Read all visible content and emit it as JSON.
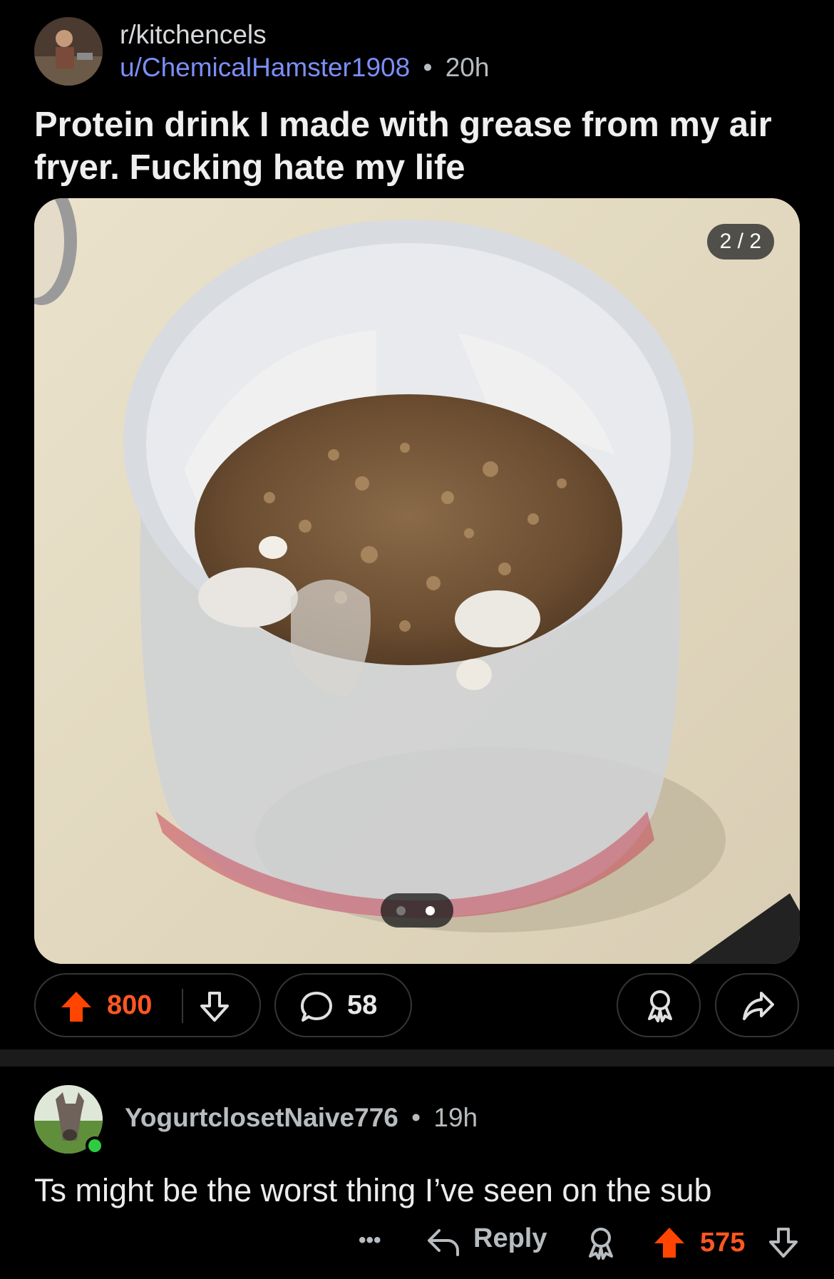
{
  "post": {
    "subreddit": "r/kitchencels",
    "author": "u/ChemicalHamster1908",
    "separator": "•",
    "age": "20h",
    "title": "Protein drink I made with grease from my air fryer. Fucking hate my life",
    "media_counter": "2 / 2",
    "gallery": {
      "current_index": 2,
      "total": 2
    },
    "upvotes": "800",
    "comments": "58"
  },
  "comment": {
    "author": "YogurtclosetNaive776",
    "separator": "•",
    "age": "19h",
    "body": "Ts might be the worst thing I’ve seen on the sub",
    "more_label": "•••",
    "reply_label": "Reply",
    "upvotes": "575"
  },
  "colors": {
    "upvote_active": "#ff4500",
    "username_link": "#7b8ff5",
    "online_indicator": "#2ecc40"
  },
  "icons": [
    "upvote-icon",
    "downvote-icon",
    "comment-icon",
    "award-icon",
    "share-icon",
    "reply-icon",
    "more-icon"
  ]
}
